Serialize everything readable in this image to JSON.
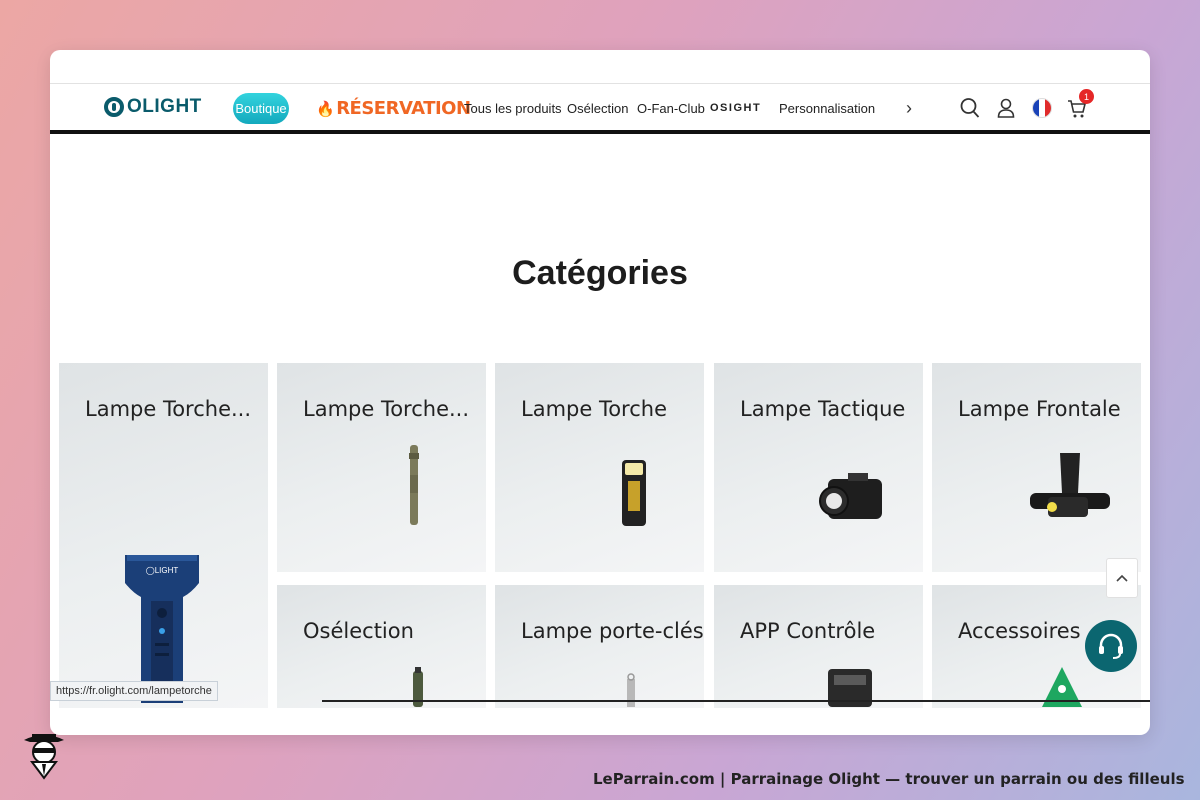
{
  "nav": {
    "logo_text": "OLIGHT",
    "boutique": "Boutique",
    "reservation": "RÉSERVATION",
    "links": [
      "Tous les produits",
      "Osélection",
      "O-Fan-Club"
    ],
    "osight": "OSIGHT",
    "personnalisation": "Personnalisation",
    "cart_count": "1"
  },
  "main": {
    "heading": "Catégories"
  },
  "categories": [
    "Lampe Torche...",
    "Lampe Torche...",
    "Lampe Torche",
    "Lampe Tactique",
    "Lampe Frontale",
    "Osélection",
    "Lampe porte-clés",
    "APP Contrôle",
    "Accessoires"
  ],
  "status_url": "https://fr.olight.com/lampetorche",
  "footer": "LeParrain.com | Parrainage Olight — trouver un parrain ou des filleuls",
  "colors": {
    "brand": "#0a5b6b",
    "boutique": "#1ab8c8",
    "reservation": "#f06724",
    "badge": "#e52727"
  },
  "icons": [
    "search-icon",
    "user-icon",
    "french-flag-icon",
    "cart-icon",
    "chevron-right-icon",
    "chevron-up-icon",
    "headset-icon"
  ]
}
